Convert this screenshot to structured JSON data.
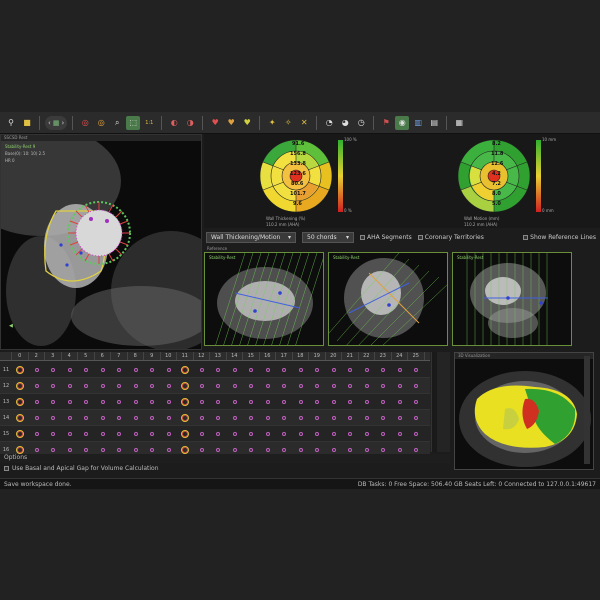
{
  "toolbar": {
    "nav_back_icon": "chevron-left-icon",
    "nav_forward_icon": "chevron-right-icon",
    "zoom_label": "1:1"
  },
  "short_axis_panel": {
    "title": "SSCSD Rest",
    "series_label": "Stability-Rest 9",
    "info_line_1": "Base(0): 10: 10) 2.5",
    "info_line_2": "HR 0"
  },
  "bullseye_left": {
    "caption_1": "Wall Thickening (%)",
    "caption_2": "110.2 mm (AHA)",
    "values": [
      "91.6",
      "156.8",
      "133.8",
      "123.6",
      "80.6",
      "101.7",
      "9.6"
    ],
    "scale_top": "100 %",
    "scale_bottom": "0 %"
  },
  "bullseye_right": {
    "caption_1": "Wall Motion (mm)",
    "caption_2": "110.2 mm (AHA)",
    "values": [
      "8.2",
      "11.8",
      "12.6",
      "4.2",
      "7.2",
      "8.0",
      "5.0"
    ],
    "scale_top": "10 mm",
    "scale_bottom": "0 mm"
  },
  "controls": {
    "mode_select": "Wall Thickening/Motion",
    "chords_select": "50 chords",
    "aha_segments": "AHA Segments",
    "coronary_territories": "Coronary Territories",
    "show_reference_lines": "Show Reference Lines"
  },
  "long_axis": {
    "panel_title": "Reference",
    "view_1": "Stability-Rest",
    "view_2": "Stability-Rest",
    "view_3": "Stability-Rest"
  },
  "volume_panel": {
    "title": "3D Visualization"
  },
  "timeline": {
    "columns": [
      "0",
      "2",
      "3",
      "4",
      "5",
      "6",
      "7",
      "8",
      "9",
      "10",
      "11",
      "12",
      "13",
      "14",
      "15",
      "16",
      "17",
      "18",
      "19",
      "20",
      "21",
      "22",
      "23",
      "24",
      "25"
    ],
    "rows": [
      "11",
      "12",
      "13",
      "14",
      "15",
      "16"
    ]
  },
  "options": {
    "header": "Options",
    "basal_apical_label": "Use Basal and Apical Gap for Volume Calculation"
  },
  "status": {
    "left": "Save workspace done.",
    "right": "DB Tasks: 0  Free Space: 506.40 GB  Seats Left: 0  Connected to 127.0.0.1:49617"
  }
}
